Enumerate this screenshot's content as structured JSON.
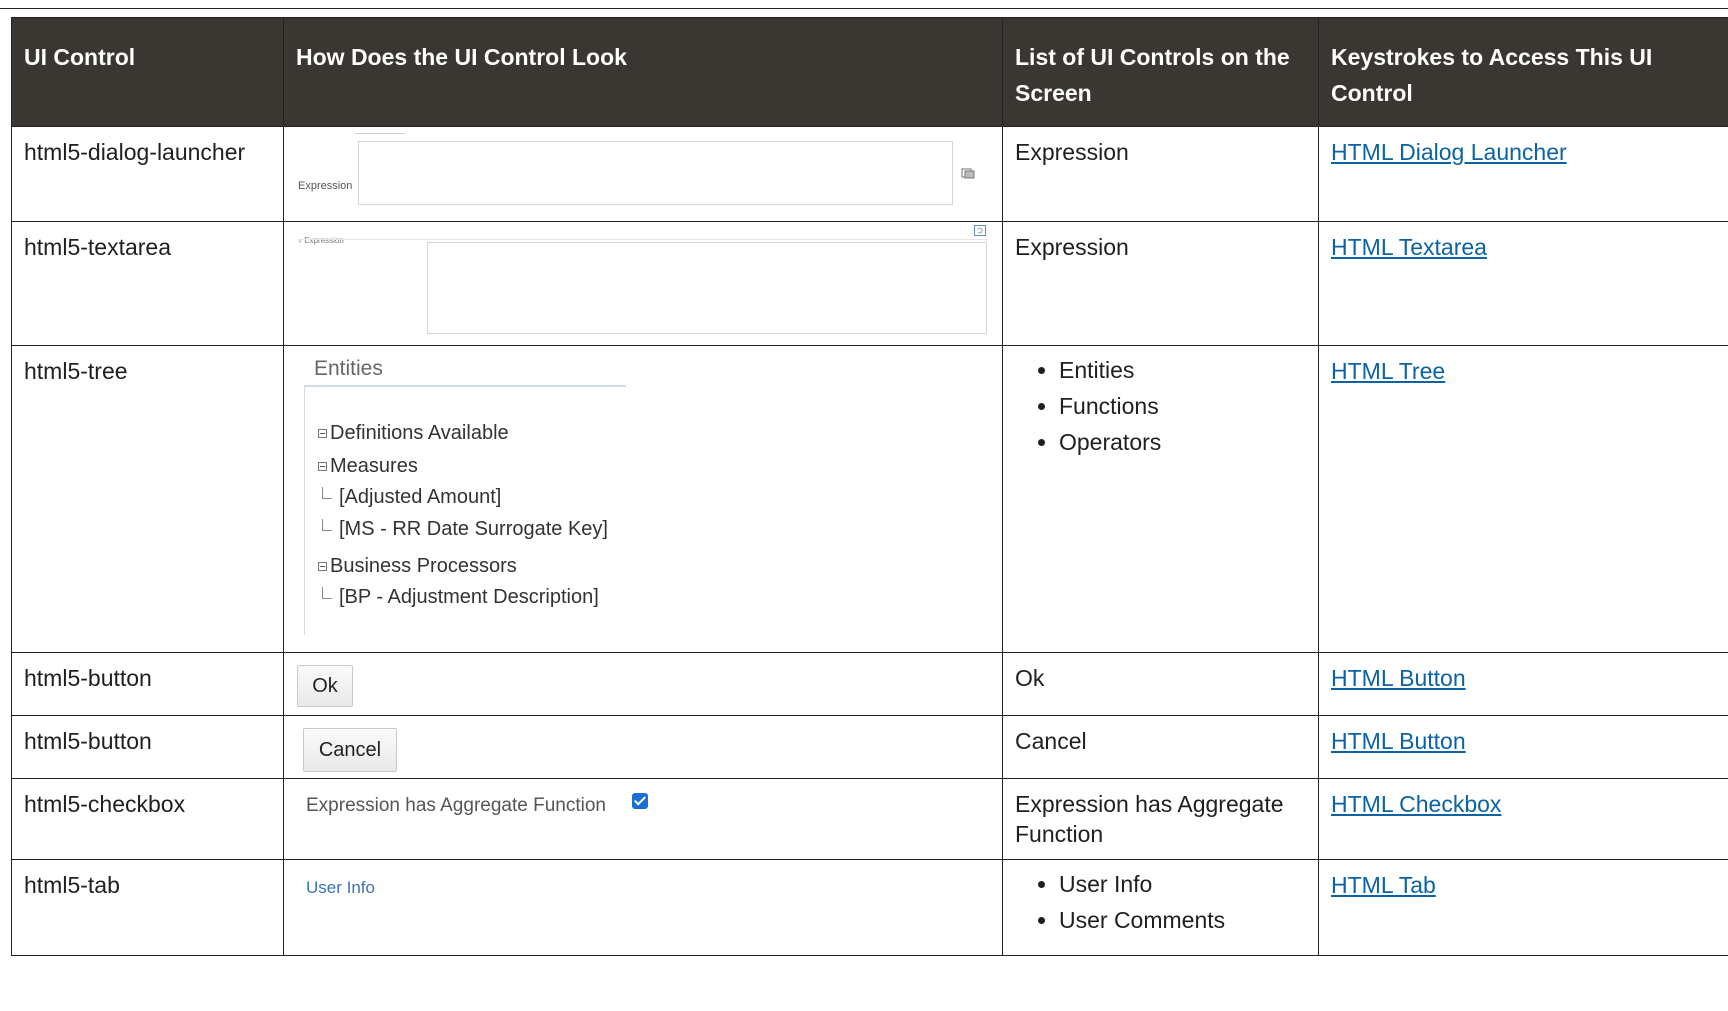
{
  "headers": [
    "UI Control",
    "How Does the UI Control Look",
    "List of UI Controls on the Screen",
    "Keystrokes to Access This UI Control"
  ],
  "rows": [
    {
      "control": "html5-dialog-launcher",
      "look": {
        "label": "Expression",
        "icon": "dialog-launcher-icon"
      },
      "controls": [
        "Expression"
      ],
      "keystroke": "HTML Dialog Launcher"
    },
    {
      "control": "html5-textarea",
      "look": {
        "label": "Expression",
        "icon": "restore-icon"
      },
      "controls": [
        "Expression"
      ],
      "keystroke": "HTML Textarea"
    },
    {
      "control": "html5-tree",
      "look": {
        "title": "Entities",
        "nodes": [
          "Definitions Available",
          "Measures",
          "[Adjusted Amount]",
          "[MS - RR Date Surrogate Key]",
          "Business Processors",
          "[BP - Adjustment Description]"
        ]
      },
      "controls": [
        "Entities",
        "Functions",
        "Operators"
      ],
      "keystroke": "HTML Tree"
    },
    {
      "control": "html5-button",
      "look": {
        "button": "Ok"
      },
      "controls": [
        "Ok"
      ],
      "keystroke": "HTML Button"
    },
    {
      "control": "html5-button",
      "look": {
        "button": "Cancel"
      },
      "controls": [
        "Cancel"
      ],
      "keystroke": "HTML Button"
    },
    {
      "control": "html5-checkbox",
      "look": {
        "label": "Expression has Aggregate Function",
        "checked": true
      },
      "controls": [
        "Expression has Aggregate Function"
      ],
      "keystroke": "HTML Checkbox"
    },
    {
      "control": "html5-tab",
      "look": {
        "tab": "User Info"
      },
      "controls": [
        "User Info",
        "User Comments"
      ],
      "keystroke": "HTML Tab"
    }
  ]
}
